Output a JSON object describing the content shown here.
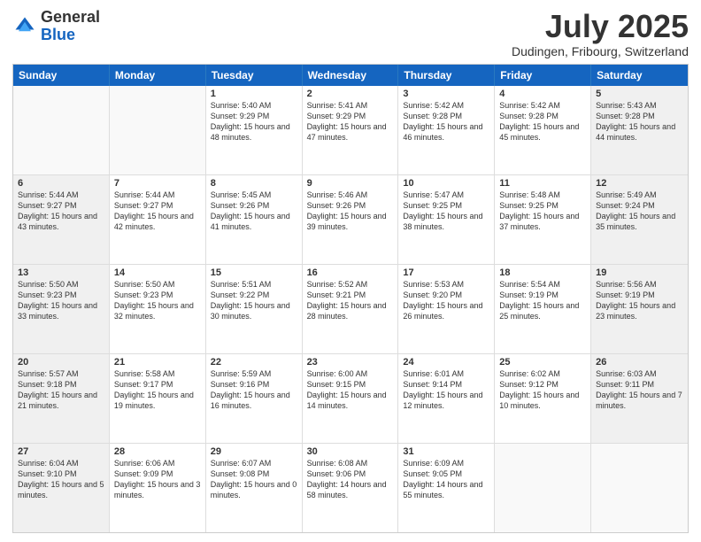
{
  "logo": {
    "general": "General",
    "blue": "Blue"
  },
  "title": {
    "month": "July 2025",
    "location": "Dudingen, Fribourg, Switzerland"
  },
  "weekdays": [
    "Sunday",
    "Monday",
    "Tuesday",
    "Wednesday",
    "Thursday",
    "Friday",
    "Saturday"
  ],
  "rows": [
    [
      {
        "day": "",
        "info": "",
        "empty": true
      },
      {
        "day": "",
        "info": "",
        "empty": true
      },
      {
        "day": "1",
        "info": "Sunrise: 5:40 AM\nSunset: 9:29 PM\nDaylight: 15 hours\nand 48 minutes."
      },
      {
        "day": "2",
        "info": "Sunrise: 5:41 AM\nSunset: 9:29 PM\nDaylight: 15 hours\nand 47 minutes."
      },
      {
        "day": "3",
        "info": "Sunrise: 5:42 AM\nSunset: 9:28 PM\nDaylight: 15 hours\nand 46 minutes."
      },
      {
        "day": "4",
        "info": "Sunrise: 5:42 AM\nSunset: 9:28 PM\nDaylight: 15 hours\nand 45 minutes."
      },
      {
        "day": "5",
        "info": "Sunrise: 5:43 AM\nSunset: 9:28 PM\nDaylight: 15 hours\nand 44 minutes.",
        "shaded": true
      }
    ],
    [
      {
        "day": "6",
        "info": "Sunrise: 5:44 AM\nSunset: 9:27 PM\nDaylight: 15 hours\nand 43 minutes.",
        "shaded": true
      },
      {
        "day": "7",
        "info": "Sunrise: 5:44 AM\nSunset: 9:27 PM\nDaylight: 15 hours\nand 42 minutes."
      },
      {
        "day": "8",
        "info": "Sunrise: 5:45 AM\nSunset: 9:26 PM\nDaylight: 15 hours\nand 41 minutes."
      },
      {
        "day": "9",
        "info": "Sunrise: 5:46 AM\nSunset: 9:26 PM\nDaylight: 15 hours\nand 39 minutes."
      },
      {
        "day": "10",
        "info": "Sunrise: 5:47 AM\nSunset: 9:25 PM\nDaylight: 15 hours\nand 38 minutes."
      },
      {
        "day": "11",
        "info": "Sunrise: 5:48 AM\nSunset: 9:25 PM\nDaylight: 15 hours\nand 37 minutes."
      },
      {
        "day": "12",
        "info": "Sunrise: 5:49 AM\nSunset: 9:24 PM\nDaylight: 15 hours\nand 35 minutes.",
        "shaded": true
      }
    ],
    [
      {
        "day": "13",
        "info": "Sunrise: 5:50 AM\nSunset: 9:23 PM\nDaylight: 15 hours\nand 33 minutes.",
        "shaded": true
      },
      {
        "day": "14",
        "info": "Sunrise: 5:50 AM\nSunset: 9:23 PM\nDaylight: 15 hours\nand 32 minutes."
      },
      {
        "day": "15",
        "info": "Sunrise: 5:51 AM\nSunset: 9:22 PM\nDaylight: 15 hours\nand 30 minutes."
      },
      {
        "day": "16",
        "info": "Sunrise: 5:52 AM\nSunset: 9:21 PM\nDaylight: 15 hours\nand 28 minutes."
      },
      {
        "day": "17",
        "info": "Sunrise: 5:53 AM\nSunset: 9:20 PM\nDaylight: 15 hours\nand 26 minutes."
      },
      {
        "day": "18",
        "info": "Sunrise: 5:54 AM\nSunset: 9:19 PM\nDaylight: 15 hours\nand 25 minutes."
      },
      {
        "day": "19",
        "info": "Sunrise: 5:56 AM\nSunset: 9:19 PM\nDaylight: 15 hours\nand 23 minutes.",
        "shaded": true
      }
    ],
    [
      {
        "day": "20",
        "info": "Sunrise: 5:57 AM\nSunset: 9:18 PM\nDaylight: 15 hours\nand 21 minutes.",
        "shaded": true
      },
      {
        "day": "21",
        "info": "Sunrise: 5:58 AM\nSunset: 9:17 PM\nDaylight: 15 hours\nand 19 minutes."
      },
      {
        "day": "22",
        "info": "Sunrise: 5:59 AM\nSunset: 9:16 PM\nDaylight: 15 hours\nand 16 minutes."
      },
      {
        "day": "23",
        "info": "Sunrise: 6:00 AM\nSunset: 9:15 PM\nDaylight: 15 hours\nand 14 minutes."
      },
      {
        "day": "24",
        "info": "Sunrise: 6:01 AM\nSunset: 9:14 PM\nDaylight: 15 hours\nand 12 minutes."
      },
      {
        "day": "25",
        "info": "Sunrise: 6:02 AM\nSunset: 9:12 PM\nDaylight: 15 hours\nand 10 minutes."
      },
      {
        "day": "26",
        "info": "Sunrise: 6:03 AM\nSunset: 9:11 PM\nDaylight: 15 hours\nand 7 minutes.",
        "shaded": true
      }
    ],
    [
      {
        "day": "27",
        "info": "Sunrise: 6:04 AM\nSunset: 9:10 PM\nDaylight: 15 hours\nand 5 minutes.",
        "shaded": true
      },
      {
        "day": "28",
        "info": "Sunrise: 6:06 AM\nSunset: 9:09 PM\nDaylight: 15 hours\nand 3 minutes."
      },
      {
        "day": "29",
        "info": "Sunrise: 6:07 AM\nSunset: 9:08 PM\nDaylight: 15 hours\nand 0 minutes."
      },
      {
        "day": "30",
        "info": "Sunrise: 6:08 AM\nSunset: 9:06 PM\nDaylight: 14 hours\nand 58 minutes."
      },
      {
        "day": "31",
        "info": "Sunrise: 6:09 AM\nSunset: 9:05 PM\nDaylight: 14 hours\nand 55 minutes."
      },
      {
        "day": "",
        "info": "",
        "empty": true
      },
      {
        "day": "",
        "info": "",
        "empty": true,
        "shaded": true
      }
    ]
  ]
}
